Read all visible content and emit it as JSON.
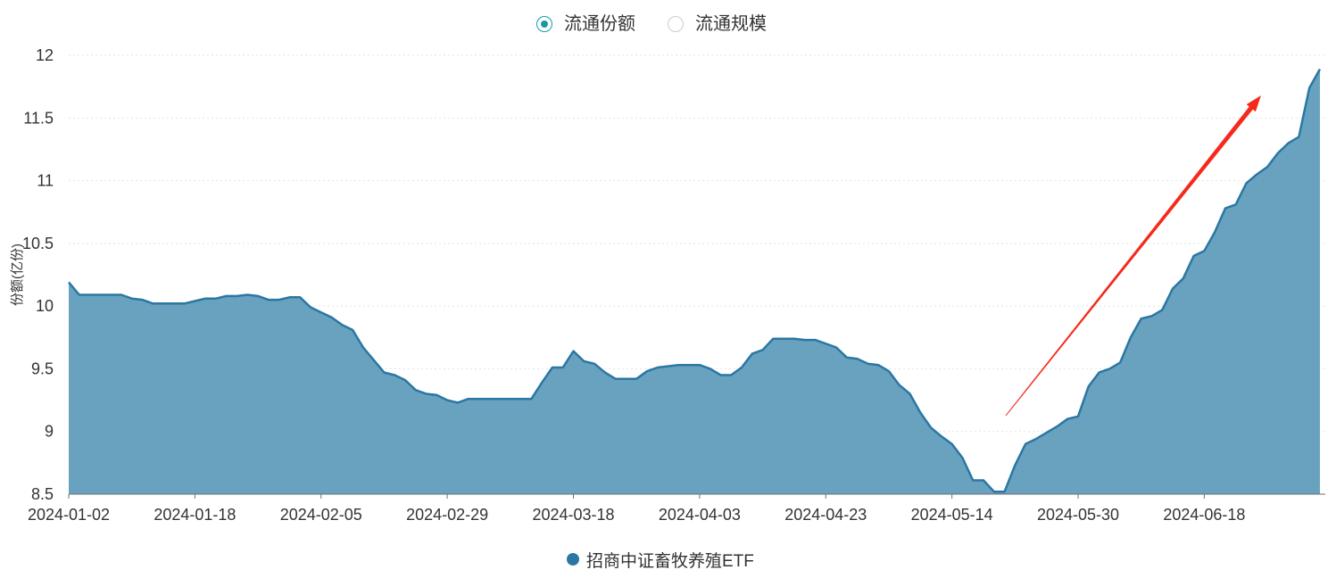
{
  "tabs": [
    {
      "label": "流通份额",
      "selected": true
    },
    {
      "label": "流通规模",
      "selected": false
    }
  ],
  "colors": {
    "radio_active": "#1c98a4",
    "radio_inactive": "#cccccc",
    "line": "#2a77a3",
    "area": "#69a2bf",
    "legend_marker": "#2a77a3",
    "grid": "#e2e2e2",
    "axis": "#6e7079",
    "annotation_arrow": "#f52a1c"
  },
  "chart_data": {
    "type": "area",
    "ylabel": "份额(亿份)",
    "ylim": [
      8.5,
      12
    ],
    "yticks": [
      8.5,
      9,
      9.5,
      10,
      10.5,
      11,
      11.5,
      12
    ],
    "ytick_labels": [
      "8.5",
      "9",
      "9.5",
      "10",
      "10.5",
      "11",
      "11.5",
      "12"
    ],
    "xtick_labels": [
      "2024-01-02",
      "2024-01-18",
      "2024-02-05",
      "2024-02-29",
      "2024-03-18",
      "2024-04-03",
      "2024-04-23",
      "2024-05-14",
      "2024-05-30",
      "2024-06-18"
    ],
    "grid": true,
    "legend": "bottom-center",
    "x": [
      "2024-01-02",
      "2024-01-03",
      "2024-01-04",
      "2024-01-05",
      "2024-01-08",
      "2024-01-09",
      "2024-01-10",
      "2024-01-11",
      "2024-01-12",
      "2024-01-15",
      "2024-01-16",
      "2024-01-17",
      "2024-01-18",
      "2024-01-19",
      "2024-01-22",
      "2024-01-23",
      "2024-01-24",
      "2024-01-25",
      "2024-01-26",
      "2024-01-29",
      "2024-01-30",
      "2024-01-31",
      "2024-02-01",
      "2024-02-02",
      "2024-02-05",
      "2024-02-06",
      "2024-02-07",
      "2024-02-08",
      "2024-02-19",
      "2024-02-20",
      "2024-02-21",
      "2024-02-22",
      "2024-02-23",
      "2024-02-26",
      "2024-02-27",
      "2024-02-28",
      "2024-02-29",
      "2024-03-01",
      "2024-03-04",
      "2024-03-05",
      "2024-03-06",
      "2024-03-07",
      "2024-03-08",
      "2024-03-11",
      "2024-03-12",
      "2024-03-13",
      "2024-03-14",
      "2024-03-15",
      "2024-03-18",
      "2024-03-19",
      "2024-03-20",
      "2024-03-21",
      "2024-03-22",
      "2024-03-25",
      "2024-03-26",
      "2024-03-27",
      "2024-03-28",
      "2024-03-29",
      "2024-04-01",
      "2024-04-02",
      "2024-04-03",
      "2024-04-08",
      "2024-04-09",
      "2024-04-10",
      "2024-04-11",
      "2024-04-12",
      "2024-04-15",
      "2024-04-16",
      "2024-04-17",
      "2024-04-18",
      "2024-04-19",
      "2024-04-22",
      "2024-04-23",
      "2024-04-24",
      "2024-04-25",
      "2024-04-26",
      "2024-04-29",
      "2024-04-30",
      "2024-05-06",
      "2024-05-07",
      "2024-05-08",
      "2024-05-09",
      "2024-05-10",
      "2024-05-13",
      "2024-05-14",
      "2024-05-15",
      "2024-05-16",
      "2024-05-17",
      "2024-05-20",
      "2024-05-21",
      "2024-05-22",
      "2024-05-23",
      "2024-05-24",
      "2024-05-27",
      "2024-05-28",
      "2024-05-29",
      "2024-05-30",
      "2024-05-31",
      "2024-06-03",
      "2024-06-04",
      "2024-06-05",
      "2024-06-06",
      "2024-06-07",
      "2024-06-11",
      "2024-06-12",
      "2024-06-13",
      "2024-06-14",
      "2024-06-17",
      "2024-06-18",
      "2024-06-19",
      "2024-06-20",
      "2024-06-21",
      "2024-06-24",
      "2024-06-25",
      "2024-06-26",
      "2024-06-27",
      "2024-06-28",
      "2024-07-01",
      "2024-07-02",
      "2024-07-03"
    ],
    "series": [
      {
        "name": "招商中证畜牧养殖ETF",
        "values": [
          10.19,
          10.09,
          10.09,
          10.09,
          10.09,
          10.09,
          10.06,
          10.05,
          10.02,
          10.02,
          10.02,
          10.02,
          10.04,
          10.06,
          10.06,
          10.08,
          10.08,
          10.09,
          10.08,
          10.05,
          10.05,
          10.07,
          10.07,
          9.99,
          9.95,
          9.91,
          9.85,
          9.81,
          9.67,
          9.57,
          9.47,
          9.45,
          9.41,
          9.33,
          9.3,
          9.29,
          9.25,
          9.23,
          9.26,
          9.26,
          9.26,
          9.26,
          9.26,
          9.26,
          9.26,
          9.39,
          9.51,
          9.51,
          9.64,
          9.56,
          9.54,
          9.47,
          9.42,
          9.42,
          9.42,
          9.48,
          9.51,
          9.52,
          9.53,
          9.53,
          9.53,
          9.5,
          9.45,
          9.45,
          9.51,
          9.62,
          9.65,
          9.74,
          9.74,
          9.74,
          9.73,
          9.73,
          9.7,
          9.67,
          9.59,
          9.58,
          9.54,
          9.53,
          9.48,
          9.37,
          9.3,
          9.15,
          9.03,
          8.96,
          8.9,
          8.79,
          8.61,
          8.61,
          8.52,
          8.52,
          8.73,
          8.9,
          8.94,
          8.99,
          9.04,
          9.1,
          9.12,
          9.36,
          9.47,
          9.5,
          9.55,
          9.75,
          9.9,
          9.92,
          9.97,
          10.14,
          10.22,
          10.4,
          10.44,
          10.59,
          10.78,
          10.81,
          10.98,
          11.05,
          11.11,
          11.22,
          11.3,
          11.35,
          11.74,
          11.89
        ]
      }
    ]
  }
}
